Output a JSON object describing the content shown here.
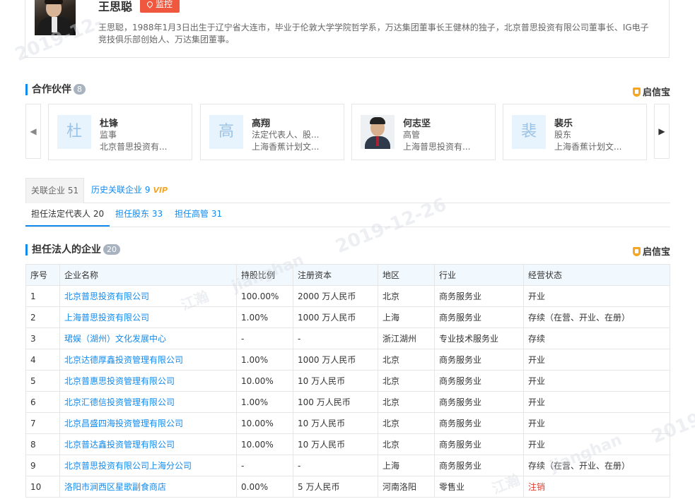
{
  "profile": {
    "name": "王思聪",
    "monitor_label": "监控",
    "description": "王思聪，1988年1月3日出生于辽宁省大连市，毕业于伦敦大学学院哲学系，万达集团董事长王健林的独子，北京普思投资有限公司董事长、IG电子竞技俱乐部创始人、万达集团董事。"
  },
  "partners_section": {
    "title": "合作伙伴",
    "count": "8",
    "brand": "启信宝",
    "partners": [
      {
        "initial": "杜",
        "name": "杜锋",
        "role": "监事",
        "company": "北京普思投资有..."
      },
      {
        "initial": "高",
        "name": "高翔",
        "role": "法定代表人、股...",
        "company": "上海香蕉计划文..."
      },
      {
        "initial": "",
        "name": "何志坚",
        "role": "高管",
        "company": "上海普思投资有..."
      },
      {
        "initial": "裴",
        "name": "裴乐",
        "role": "股东",
        "company": "上海香蕉计划文..."
      }
    ]
  },
  "tabs": {
    "related": "关联企业 51",
    "history": "历史关联企业 9",
    "vip": "VIP"
  },
  "subtabs": {
    "legal_rep": "担任法定代表人 20",
    "shareholder": "担任股东 33",
    "executive": "担任高管 31"
  },
  "legal_section": {
    "title": "担任法人的企业",
    "count": "20",
    "brand": "启信宝"
  },
  "table": {
    "headers": [
      "序号",
      "企业名称",
      "持股比例",
      "注册资本",
      "地区",
      "行业",
      "经营状态"
    ],
    "rows": [
      [
        "1",
        "北京普思投资有限公司",
        "100.00%",
        "2000 万人民币",
        "北京",
        "商务服务业",
        "开业"
      ],
      [
        "2",
        "上海普思投资有限公司",
        "1.00%",
        "1000 万人民币",
        "上海",
        "商务服务业",
        "存续（在营、开业、在册）"
      ],
      [
        "3",
        "珺娱（湖州）文化发展中心",
        "-",
        "-",
        "浙江湖州",
        "专业技术服务业",
        "存续"
      ],
      [
        "4",
        "北京达德厚鑫投资管理有限公司",
        "1.00%",
        "1000 万人民币",
        "北京",
        "商务服务业",
        "开业"
      ],
      [
        "5",
        "北京普惠思投资管理有限公司",
        "10.00%",
        "10 万人民币",
        "北京",
        "商务服务业",
        "开业"
      ],
      [
        "6",
        "北京汇德信投资管理有限公司",
        "1.00%",
        "100 万人民币",
        "北京",
        "商务服务业",
        "开业"
      ],
      [
        "7",
        "北京昌盛四海投资管理有限公司",
        "10.00%",
        "10 万人民币",
        "北京",
        "商务服务业",
        "开业"
      ],
      [
        "8",
        "北京普达鑫投资管理有限公司",
        "10.00%",
        "10 万人民币",
        "北京",
        "商务服务业",
        "开业"
      ],
      [
        "9",
        "北京普思投资有限公司上海分公司",
        "-",
        "-",
        "上海",
        "商务服务业",
        "存续（在营、开业、在册）"
      ],
      [
        "10",
        "洛阳市涧西区星歌副食商店",
        "0.00%",
        "5 万人民币",
        "河南洛阳",
        "零售业",
        "注销"
      ]
    ]
  },
  "watermarks": [
    "2019-12-",
    "2019-12-26",
    "江瀚",
    "jianghan",
    "2019-",
    "江瀚",
    "jianghan"
  ],
  "colors": {
    "accent": "#128bed",
    "monitor": "#f0573f",
    "vip": "#f5a623",
    "deregistered": "#e43a2f"
  }
}
